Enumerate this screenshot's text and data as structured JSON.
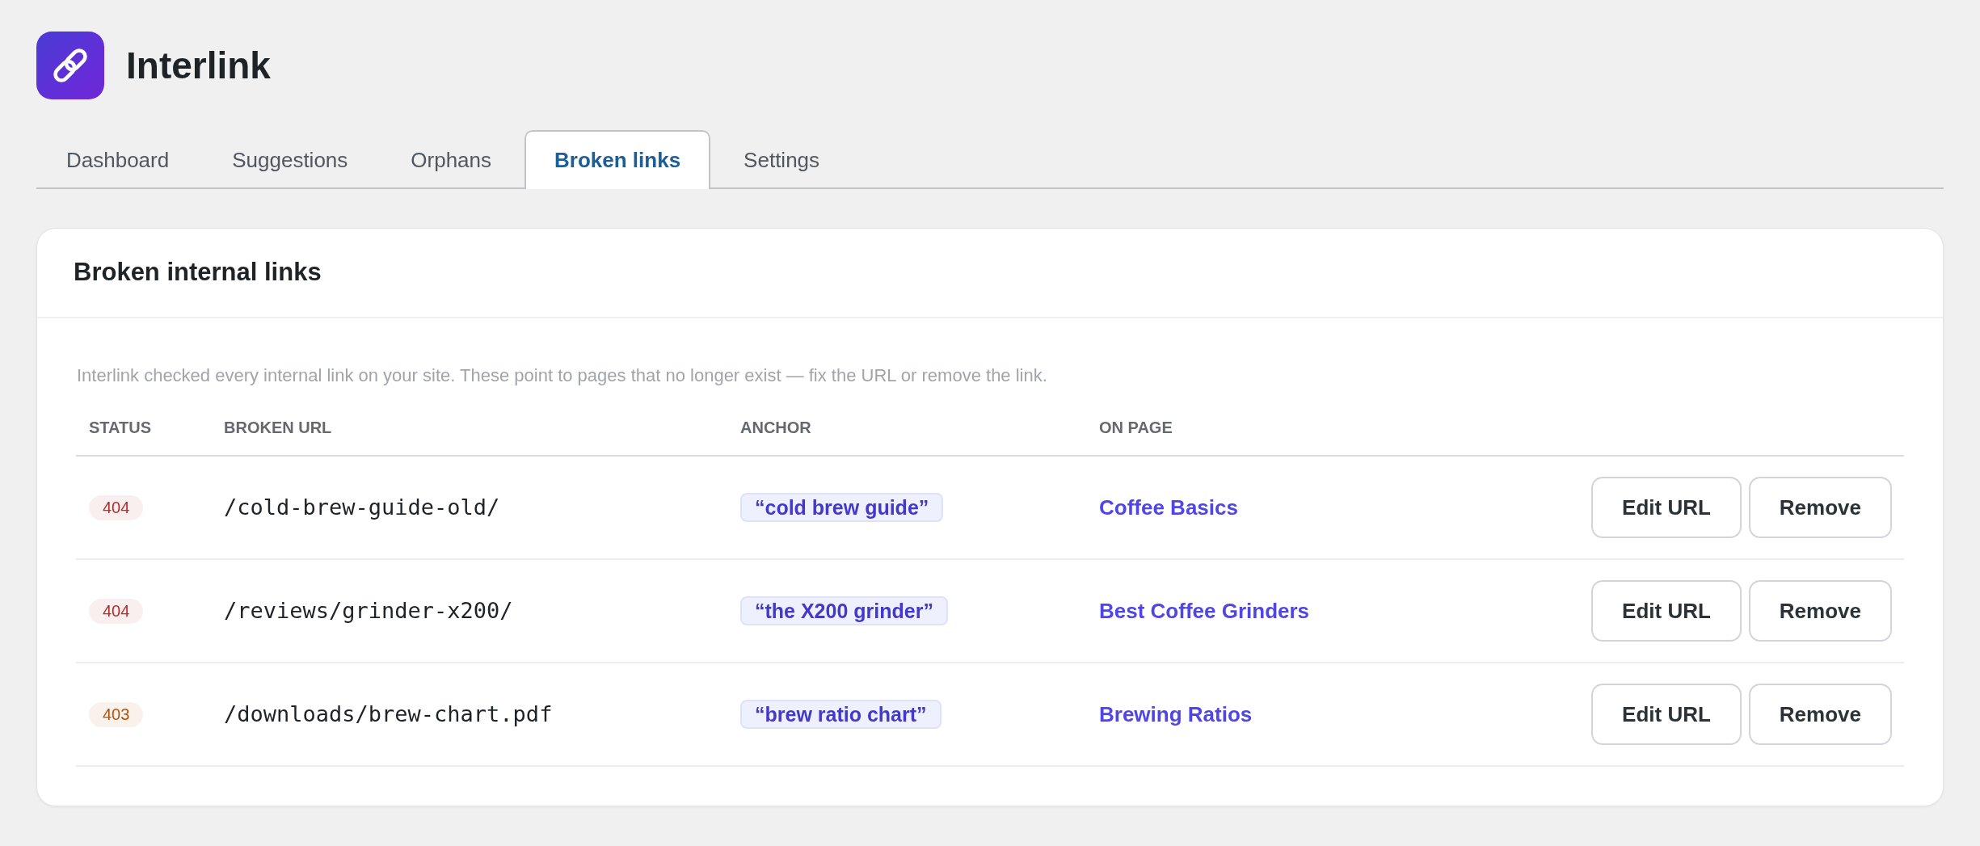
{
  "app": {
    "name": "Interlink"
  },
  "tabs": [
    {
      "label": "Dashboard",
      "selected": false
    },
    {
      "label": "Suggestions",
      "selected": false
    },
    {
      "label": "Orphans",
      "selected": false
    },
    {
      "label": "Broken links",
      "selected": true
    },
    {
      "label": "Settings",
      "selected": false
    }
  ],
  "card": {
    "title": "Broken internal links",
    "description": "Interlink checked every internal link on your site. These point to pages that no longer exist — fix the URL or remove the link.",
    "table": {
      "columns": [
        "STATUS",
        "BROKEN URL",
        "ANCHOR",
        "ON PAGE"
      ],
      "rows": [
        {
          "status": {
            "code": "404",
            "color": "#b32d2e"
          },
          "broken_url": "/cold-brew-guide-old/",
          "anchor": "“cold brew guide”",
          "on_page": "Coffee Basics",
          "actions": [
            "Edit URL",
            "Remove"
          ]
        },
        {
          "status": {
            "code": "404",
            "color": "#b32d2e"
          },
          "broken_url": "/reviews/grinder-x200/",
          "anchor": "“the X200 grinder”",
          "on_page": "Best Coffee Grinders",
          "actions": [
            "Edit URL",
            "Remove"
          ]
        },
        {
          "status": {
            "code": "403",
            "color": "#b45309"
          },
          "broken_url": "/downloads/brew-chart.pdf",
          "anchor": "“brew ratio chart”",
          "on_page": "Brewing Ratios",
          "actions": [
            "Edit URL",
            "Remove"
          ]
        }
      ]
    }
  }
}
